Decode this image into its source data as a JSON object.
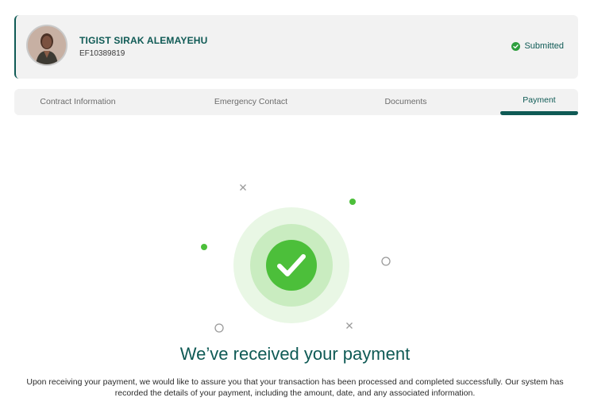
{
  "profile": {
    "name": "TIGIST SIRAK ALEMAYEHU",
    "employee_id": "EF10389819",
    "status": "Submitted",
    "status_icon": "check-circle-icon",
    "status_color": "#2e9e3e"
  },
  "tabs": [
    {
      "label": "Contract Information",
      "active": false
    },
    {
      "label": "Emergency Contact",
      "active": false
    },
    {
      "label": "Documents",
      "active": false
    },
    {
      "label": "Payment",
      "active": true
    }
  ],
  "payment_result": {
    "icon": "check-mark-icon",
    "headline": "We’ve received your payment",
    "message": "Upon receiving your payment, we would like to assure you that your transaction has been processed and completed successfully. Our system has recorded the details of your payment, including the amount, date, and any associated information."
  },
  "colors": {
    "brand": "#0f5a55",
    "success": "#4cbf3a",
    "success_light": "#c9ecc0",
    "success_lighter": "#e9f7e5",
    "panel": "#f2f2f2"
  }
}
